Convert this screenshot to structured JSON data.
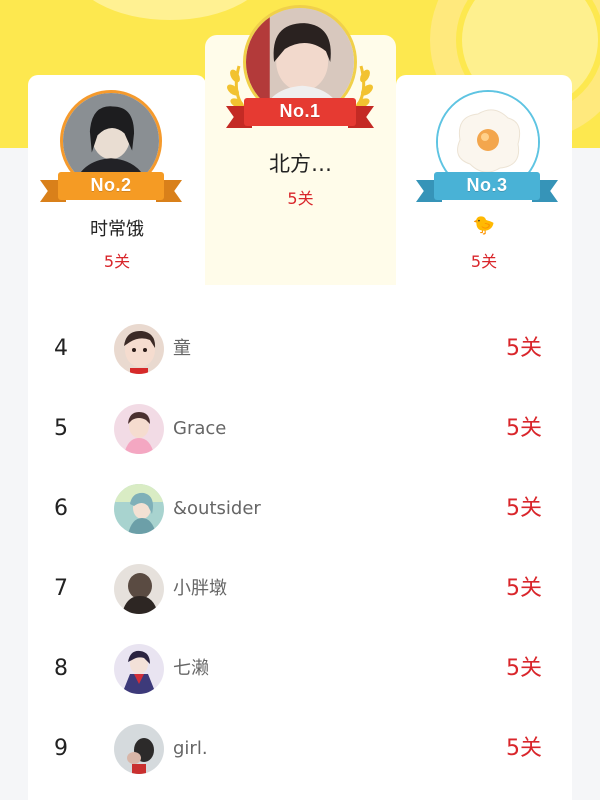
{
  "podium": [
    {
      "rank_label": "No.1",
      "name": "北方…",
      "level": "5关",
      "ribbon_color": "#e63a32"
    },
    {
      "rank_label": "No.2",
      "name": "时常饿",
      "level": "5关",
      "ribbon_color": "#f59b24"
    },
    {
      "rank_label": "No.3",
      "name": "🐤",
      "level": "5关",
      "ribbon_color": "#49b2d6"
    }
  ],
  "ranking": [
    {
      "rank": "4",
      "name": "童󠀠",
      "level": "5关"
    },
    {
      "rank": "5",
      "name": "Grace",
      "level": "5关"
    },
    {
      "rank": "6",
      "name": "&outsider",
      "level": "5关"
    },
    {
      "rank": "7",
      "name": "小胖墩",
      "level": "5关"
    },
    {
      "rank": "8",
      "name": "七濑",
      "level": "5关"
    },
    {
      "rank": "9",
      "name": "girl.",
      "level": "5关"
    }
  ],
  "colors": {
    "accent_yellow": "#fde84f",
    "level_red": "#d9262b"
  }
}
